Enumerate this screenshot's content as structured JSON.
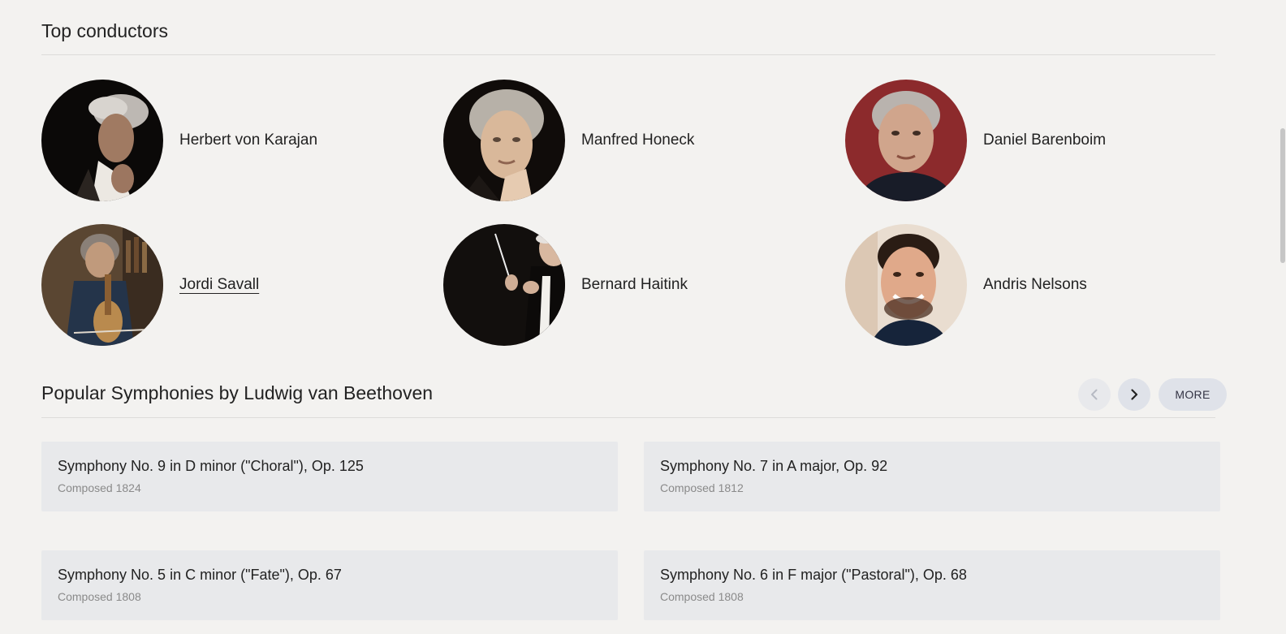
{
  "conductors_section": {
    "title": "Top conductors",
    "items": [
      {
        "name": "Herbert von Karajan"
      },
      {
        "name": "Manfred Honeck"
      },
      {
        "name": "Daniel Barenboim"
      },
      {
        "name": "Jordi Savall"
      },
      {
        "name": "Bernard Haitink"
      },
      {
        "name": "Andris Nelsons"
      }
    ]
  },
  "symphonies_section": {
    "title": "Popular Symphonies by Ludwig van Beethoven",
    "prev_icon": "chevron-left-icon",
    "next_icon": "chevron-right-icon",
    "more_label": "MORE",
    "items": [
      {
        "title": "Symphony No. 9 in D minor (\"Choral\"), Op. 125",
        "subtitle": "Composed 1824"
      },
      {
        "title": "Symphony No. 7 in A major, Op. 92",
        "subtitle": "Composed 1812"
      },
      {
        "title": "Symphony No. 5 in C minor (\"Fate\"), Op. 67",
        "subtitle": "Composed 1808"
      },
      {
        "title": "Symphony No. 6 in F major (\"Pastoral\"), Op. 68",
        "subtitle": "Composed 1808"
      }
    ]
  },
  "colors": {
    "background": "#f3f2f0",
    "card": "#e8e9eb",
    "button": "#dfe2e9"
  }
}
